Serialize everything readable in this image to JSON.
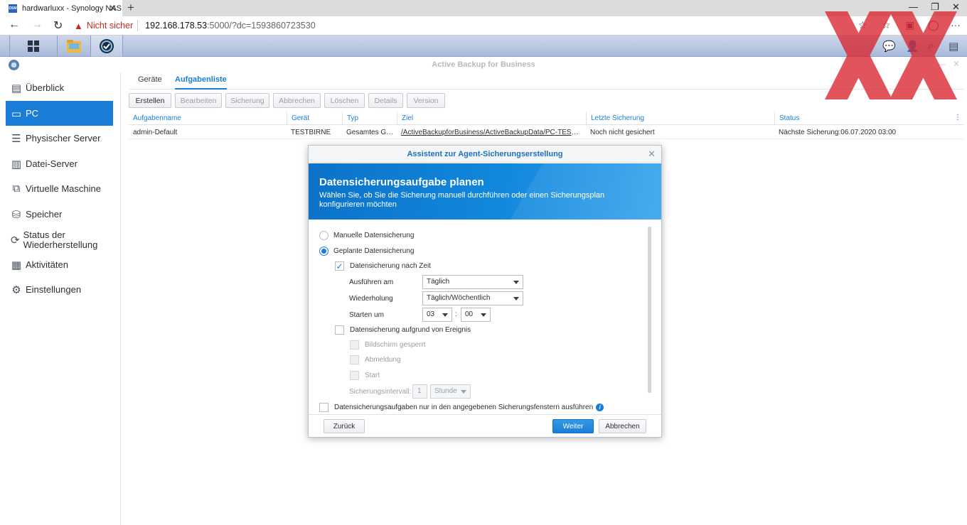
{
  "browser": {
    "tab_title": "hardwarluxx - Synology NAS",
    "favicon_text": "DSM",
    "security_label": "Nicht sicher",
    "url_host": "192.168.178.53",
    "url_path": ":5000/?dc=1593860723530"
  },
  "app": {
    "title": "Active Backup for Business"
  },
  "sidebar": {
    "items": [
      {
        "label": "Überblick",
        "icon": "overview-icon"
      },
      {
        "label": "PC",
        "icon": "pc-icon"
      },
      {
        "label": "Physischer Server",
        "icon": "server-icon"
      },
      {
        "label": "Datei-Server",
        "icon": "file-server-icon"
      },
      {
        "label": "Virtuelle Maschine",
        "icon": "vm-icon"
      },
      {
        "label": "Speicher",
        "icon": "storage-icon"
      },
      {
        "label": "Status der Wiederherstellung",
        "icon": "restore-icon"
      },
      {
        "label": "Aktivitäten",
        "icon": "activity-icon"
      },
      {
        "label": "Einstellungen",
        "icon": "settings-icon"
      }
    ],
    "active_index": 1
  },
  "content_tabs": [
    "Geräte",
    "Aufgabenliste"
  ],
  "toolbar": [
    "Erstellen",
    "Bearbeiten",
    "Sicherung",
    "Abbrechen",
    "Löschen",
    "Details",
    "Version"
  ],
  "table": {
    "columns": [
      "Aufgabenname",
      "Gerät",
      "Typ",
      "Ziel",
      "Letzte Sicherung",
      "Status"
    ],
    "rows": [
      [
        "admin-Default",
        "TESTBIRNE",
        "Gesamtes Ge...",
        "/ActiveBackupforBusiness/ActiveBackupData/PC-TESTBI...",
        "Noch nicht gesichert",
        "Nächste Sicherung:06.07.2020 03:00"
      ]
    ]
  },
  "dialog": {
    "title": "Assistent zur Agent-Sicherungserstellung",
    "heading": "Datensicherungsaufgabe planen",
    "subheading": "Wählen Sie, ob Sie die Sicherung manuell durchführen oder einen Sicherungsplan konfigurieren möchten",
    "radio_manual": "Manuelle Datensicherung",
    "radio_scheduled": "Geplante Datensicherung",
    "check_by_time": "Datensicherung nach Zeit",
    "run_on_label": "Ausführen am",
    "run_on_value": "Täglich",
    "repeat_label": "Wiederholung",
    "repeat_value": "Täglich/Wöchentlich",
    "start_label": "Starten um",
    "start_hour": "03",
    "time_sep": ":",
    "start_minute": "00",
    "check_by_event": "Datensicherung aufgrund von Ereignis",
    "event_screen_locked": "Bildschirm gesperrt",
    "event_logout": "Abmeldung",
    "event_start": "Start",
    "interval_label": "Sicherungsintervall:",
    "interval_value": "1",
    "interval_unit": "Stunde",
    "check_window": "Datensicherungsaufgaben nur in den angegebenen Sicherungsfenstern ausführen",
    "btn_back": "Zurück",
    "btn_next": "Weiter",
    "btn_cancel": "Abbrechen"
  },
  "colors": {
    "accent": "#1a7ed8",
    "taskbar": "#b8c6e0",
    "watermark": "#d9252e"
  }
}
